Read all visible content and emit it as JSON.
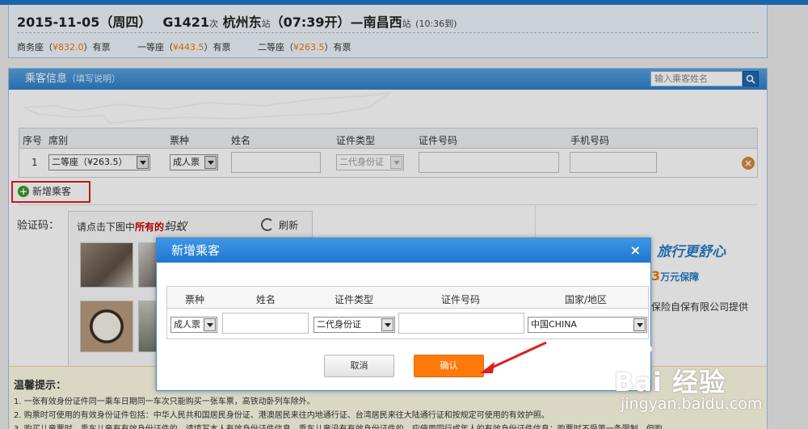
{
  "train": {
    "date": "2015-11-05（周四）",
    "number": "G1421",
    "number_suffix": "次",
    "from_station": "杭州东",
    "station_suffix": "站",
    "depart": "（07:39开）",
    "dash": "—",
    "to_station": "南昌西",
    "to_station_suffix": "站",
    "arrive": "(10:36到)",
    "seats": [
      {
        "name": "商务座（",
        "price": "¥832.0",
        "close": "）",
        "status": "有票"
      },
      {
        "name": "一等座（",
        "price": "¥443.5",
        "close": "）",
        "status": "有票"
      },
      {
        "name": "二等座（",
        "price": "¥263.5",
        "close": "）",
        "status": "有票"
      }
    ]
  },
  "passenger_panel": {
    "title": "乘客信息",
    "hint": "（填写说明）",
    "search_placeholder": "输入乘客姓名",
    "columns": [
      "序号",
      "席别",
      "票种",
      "姓名",
      "证件类型",
      "证件号码",
      "手机号码"
    ],
    "row": {
      "index": "1",
      "seat": "二等座（¥263.5）",
      "ticket_type": "成人票",
      "id_type": "二代身份证",
      "delete_icon": "close-circle-icon"
    },
    "add_passenger_label": "新增乘客",
    "captcha_label": "验证码：",
    "captcha_instruction_prefix": "请点击下图中",
    "captcha_instruction_bold": "所有的",
    "captcha_instruction_object": "蚂蚁",
    "refresh_label": "刷新",
    "ad_line1": "旅行更舒心",
    "ad_line2_big": "3",
    "ad_line2_rest": "万元保障",
    "ad_line3": "保险自保有限公司提供"
  },
  "tips": {
    "title": "温馨提示：",
    "items": [
      "1. 一张有效身份证件同一乘车日期同一车次只能购买一张车票，高铁动卧列车除外。",
      "2. 购票时可使用的有效身份证件包括：中华人民共和国居民身份证、港澳居民来往内地通行证、台湾居民来往大陆通行证和按规定可使用的有效护照。",
      "3. 购买儿童票时，乘车儿童有有效身份证件的，请填写本人有效身份证件信息。乘车儿童没有有效身份证件的，应使用同行成年人的有效身份证件信息；购票时不受第一条限制，但购"
    ]
  },
  "modal": {
    "title": "新增乘客",
    "close": "×",
    "columns": [
      "票种",
      "姓名",
      "证件类型",
      "证件号码",
      "国家/地区"
    ],
    "ticket_type": "成人票",
    "id_type": "二代身份证",
    "country": "中国CHINA",
    "cancel_label": "取消",
    "confirm_label": "确认"
  },
  "watermark": {
    "brand": "Bai 经验",
    "url": "jingyan.baidu.com"
  },
  "colors": {
    "header_blue": "#2e7fc6",
    "price_orange": "#f07a00",
    "confirm_orange": "#ff7a0c",
    "highlight_red": "#e21e1e"
  }
}
